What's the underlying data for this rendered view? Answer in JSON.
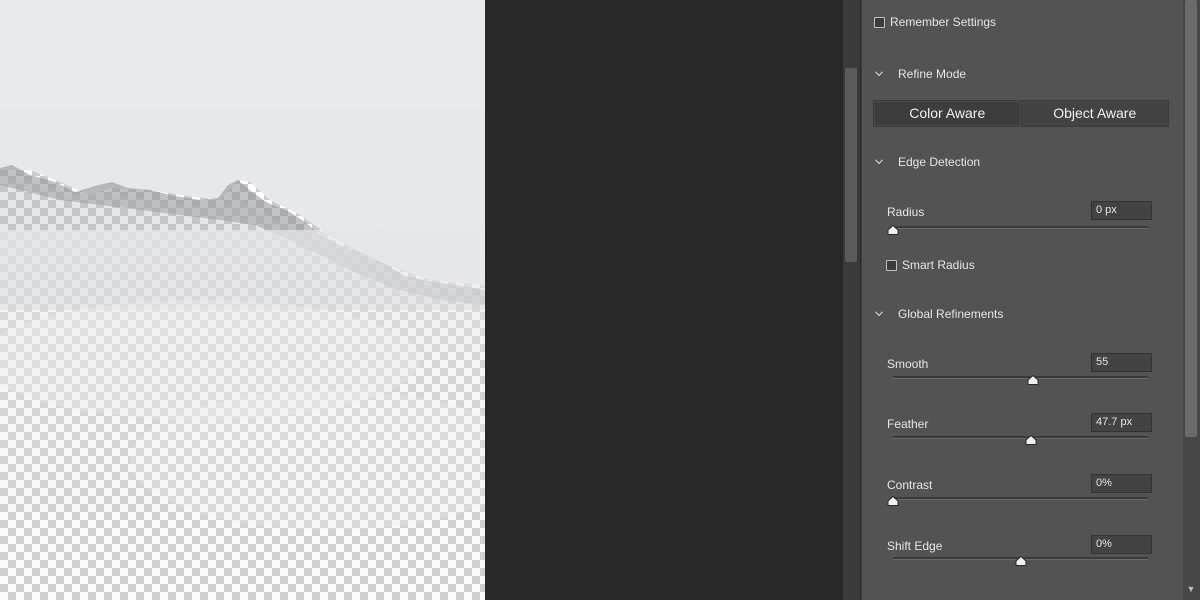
{
  "remember_settings": {
    "label": "Remember Settings",
    "checked": false
  },
  "refine_mode": {
    "header": "Refine Mode",
    "options": [
      "Color Aware",
      "Object Aware"
    ],
    "selected": "Color Aware"
  },
  "edge_detection": {
    "header": "Edge Detection",
    "radius": {
      "label": "Radius",
      "value": "0 px",
      "fraction": 0.0
    },
    "smart_radius": {
      "label": "Smart Radius",
      "checked": false
    }
  },
  "global_refinements": {
    "header": "Global Refinements",
    "smooth": {
      "label": "Smooth",
      "value": "55",
      "fraction": 0.55
    },
    "feather": {
      "label": "Feather",
      "value": "47.7 px",
      "fraction": 0.54
    },
    "contrast": {
      "label": "Contrast",
      "value": "0%",
      "fraction": 0.0
    },
    "shift_edge": {
      "label": "Shift Edge",
      "value": "0%",
      "fraction": 0.5
    }
  },
  "colors": {
    "panel": "#535353",
    "canvas_dark": "#282828"
  }
}
